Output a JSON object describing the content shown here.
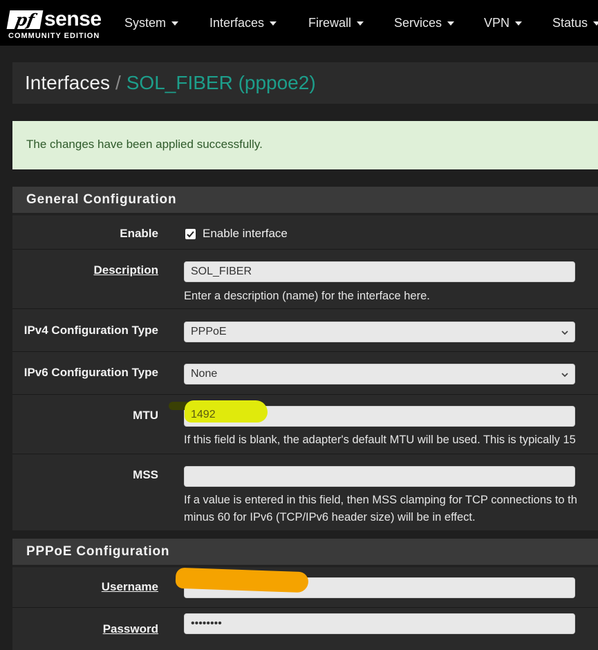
{
  "brand": {
    "logo_pf": "pf",
    "logo_sense": "sense",
    "logo_sub": "COMMUNITY EDITION"
  },
  "nav": {
    "items": [
      {
        "label": "System"
      },
      {
        "label": "Interfaces"
      },
      {
        "label": "Firewall"
      },
      {
        "label": "Services"
      },
      {
        "label": "VPN"
      },
      {
        "label": "Status"
      }
    ]
  },
  "breadcrumb": {
    "root": "Interfaces",
    "separator": "/",
    "current": "SOL_FIBER (pppoe2)"
  },
  "alert": {
    "message": "The changes have been applied successfully."
  },
  "general": {
    "title": "General Configuration",
    "enable": {
      "label": "Enable",
      "checked": true,
      "text": "Enable interface"
    },
    "description": {
      "label": "Description",
      "value": "SOL_FIBER",
      "help": "Enter a description (name) for the interface here."
    },
    "ipv4": {
      "label": "IPv4 Configuration Type",
      "selected": "PPPoE"
    },
    "ipv6": {
      "label": "IPv6 Configuration Type",
      "selected": "None"
    },
    "mtu": {
      "label": "MTU",
      "value": "1492",
      "help": "If this field is blank, the adapter's default MTU will be used. This is typically 15"
    },
    "mss": {
      "label": "MSS",
      "value": "",
      "help_line1": "If a value is entered in this field, then MSS clamping for TCP connections to th",
      "help_line2": "minus 60 for IPv6 (TCP/IPv6 header size) will be in effect."
    }
  },
  "pppoe": {
    "title": "PPPoE Configuration",
    "username": {
      "label": "Username",
      "value": ""
    },
    "password": {
      "label": "Password",
      "value": "••••••••"
    }
  },
  "colors": {
    "accent": "#1d9e8b",
    "alert_bg": "#dff0d8",
    "highlight_yellow": "#e0ea0c",
    "scribble_orange": "#f5a300"
  }
}
